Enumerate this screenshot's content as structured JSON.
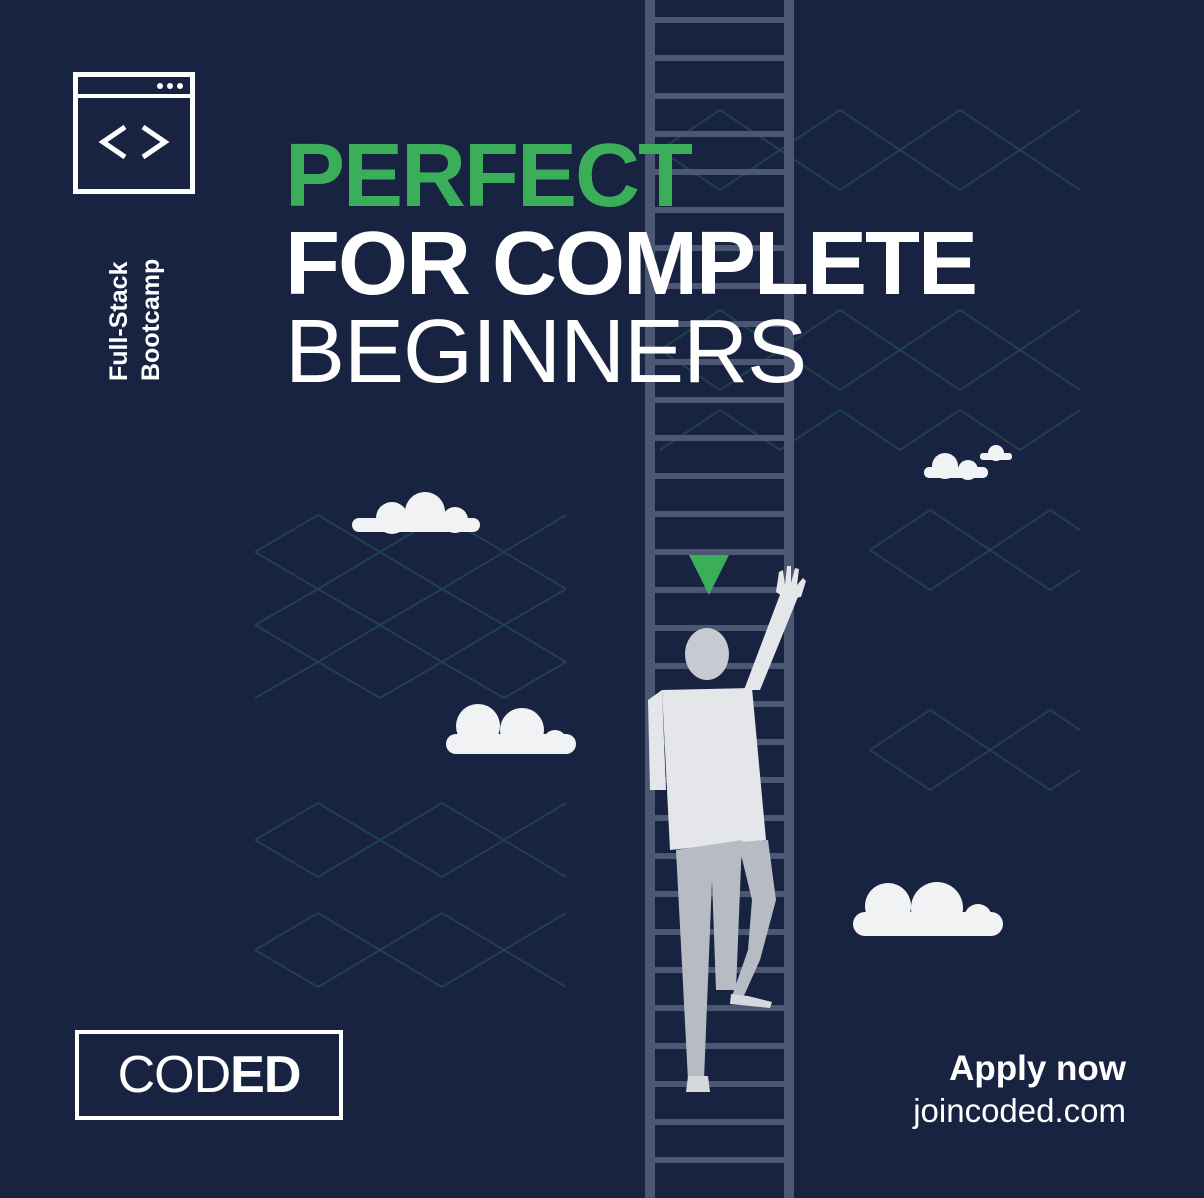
{
  "sidebar": {
    "icon": "code-window-icon",
    "label_line1": "Full-Stack",
    "label_line2": "Bootcamp"
  },
  "headline": {
    "line1": "PERFECT",
    "line2": "FOR COMPLETE",
    "line3": "BEGINNERS"
  },
  "logo": {
    "part1": "COD",
    "part2": "ED"
  },
  "cta": {
    "apply": "Apply now",
    "website": "joincoded.com"
  },
  "colors": {
    "background": "#172340",
    "accent_green": "#3aae58",
    "ladder": "#4c5773",
    "person": "#e4e6ea",
    "person_pants": "#b7bcc4",
    "cloud": "#f1f2f4"
  }
}
